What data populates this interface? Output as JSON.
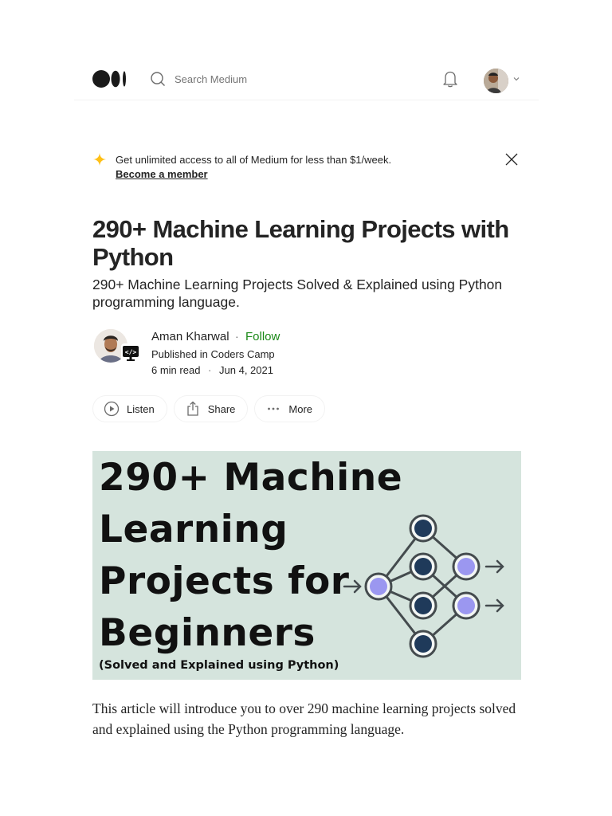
{
  "header": {
    "logo": "medium-logo",
    "search_placeholder": "Search Medium",
    "icons": {
      "search": "search-icon",
      "notifications": "bell-icon",
      "profile": "avatar",
      "menu": "chevron-down-icon"
    }
  },
  "promo": {
    "icon": "sparkle-icon",
    "text": "Get unlimited access to all of Medium for less than $1/week.",
    "link": "Become a member",
    "close_icon": "close-icon",
    "accent": "#ffc017"
  },
  "article": {
    "title": "290+ Machine Learning Projects with Python",
    "subtitle": "290+ Machine Learning Projects Solved & Explained using Python programming language.",
    "author": {
      "name": "Aman Kharwal",
      "follow_label": "Follow",
      "separator": "·",
      "published_prefix": "Published in",
      "publication": "Coders Camp",
      "read_time": "6 min read",
      "date": "Jun 4, 2021",
      "follow_color": "#1a8917"
    },
    "actions": [
      {
        "label": "Listen",
        "icon": "play-circle-icon"
      },
      {
        "label": "Share",
        "icon": "share-icon"
      },
      {
        "label": "More",
        "icon": "more-dots-icon"
      }
    ],
    "hero_image": {
      "lines": [
        "290+ Machine",
        "Learning",
        "Projects for",
        "Beginners"
      ],
      "caption": "(Solved and Explained using Python)",
      "background": "#d5e4dd",
      "node_dark": "#1f3a5a",
      "node_light": "#9b97f0",
      "stroke": "#444b4e"
    },
    "intro": "This article will introduce you to over 290 machine learning projects solved and explained using the Python programming language."
  }
}
